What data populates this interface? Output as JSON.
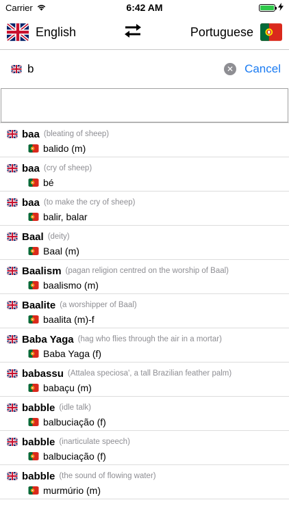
{
  "status": {
    "carrier": "Carrier",
    "time": "6:42 AM",
    "battery_percent": 100
  },
  "header": {
    "source_lang": "English",
    "target_lang": "Portuguese"
  },
  "search": {
    "value": "b",
    "cancel_label": "Cancel"
  },
  "colors": {
    "accent": "#1a7bf2",
    "note_gray": "#8e8e93"
  },
  "results": [
    {
      "term": "baa",
      "note": "(bleating of sheep)",
      "translation": "balido (m)"
    },
    {
      "term": "baa",
      "note": "(cry of sheep)",
      "translation": "bé"
    },
    {
      "term": "baa",
      "note": "(to make the cry of sheep)",
      "translation": "balir, balar"
    },
    {
      "term": "Baal",
      "note": "(deity)",
      "translation": "Baal (m)"
    },
    {
      "term": "Baalism",
      "note": "(pagan religion centred on the worship of Baal)",
      "translation": "baalismo (m)"
    },
    {
      "term": "Baalite",
      "note": "(a worshipper of Baal)",
      "translation": "baalita (m)-f"
    },
    {
      "term": "Baba Yaga",
      "note": "(hag who flies through the air in a mortar)",
      "translation": "Baba Yaga (f)"
    },
    {
      "term": "babassu",
      "note": "(Attalea speciosa', a tall Brazilian feather palm)",
      "translation": "babaçu (m)"
    },
    {
      "term": "babble",
      "note": "(idle talk)",
      "translation": "balbuciação (f)"
    },
    {
      "term": "babble",
      "note": "(inarticulate speech)",
      "translation": "balbuciação (f)"
    },
    {
      "term": "babble",
      "note": "(the sound of flowing water)",
      "translation": "murmúrio (m)"
    }
  ]
}
